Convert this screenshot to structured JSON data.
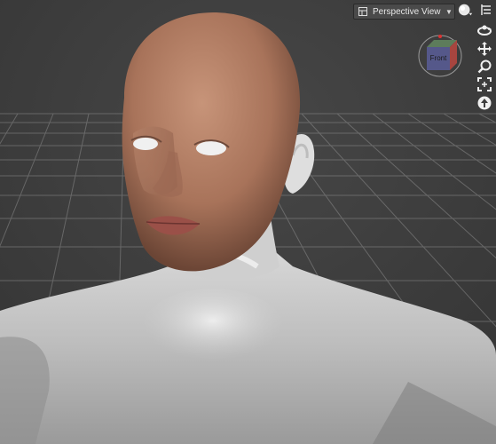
{
  "viewport": {
    "camera_selector": {
      "label": "Perspective View",
      "arrow": "▼"
    },
    "nav_cube": {
      "face_label": "Front"
    },
    "tools": [
      {
        "name": "render-preview-icon"
      },
      {
        "name": "viewport-menu-icon"
      },
      {
        "name": "orbit-icon"
      },
      {
        "name": "pan-icon"
      },
      {
        "name": "zoom-icon"
      },
      {
        "name": "frame-icon"
      },
      {
        "name": "reset-view-icon"
      }
    ]
  },
  "colors": {
    "background": "#3d3d3d",
    "grid": "#8a8a8a",
    "skin": "#b07a5e",
    "body": "#d6d6d6"
  }
}
